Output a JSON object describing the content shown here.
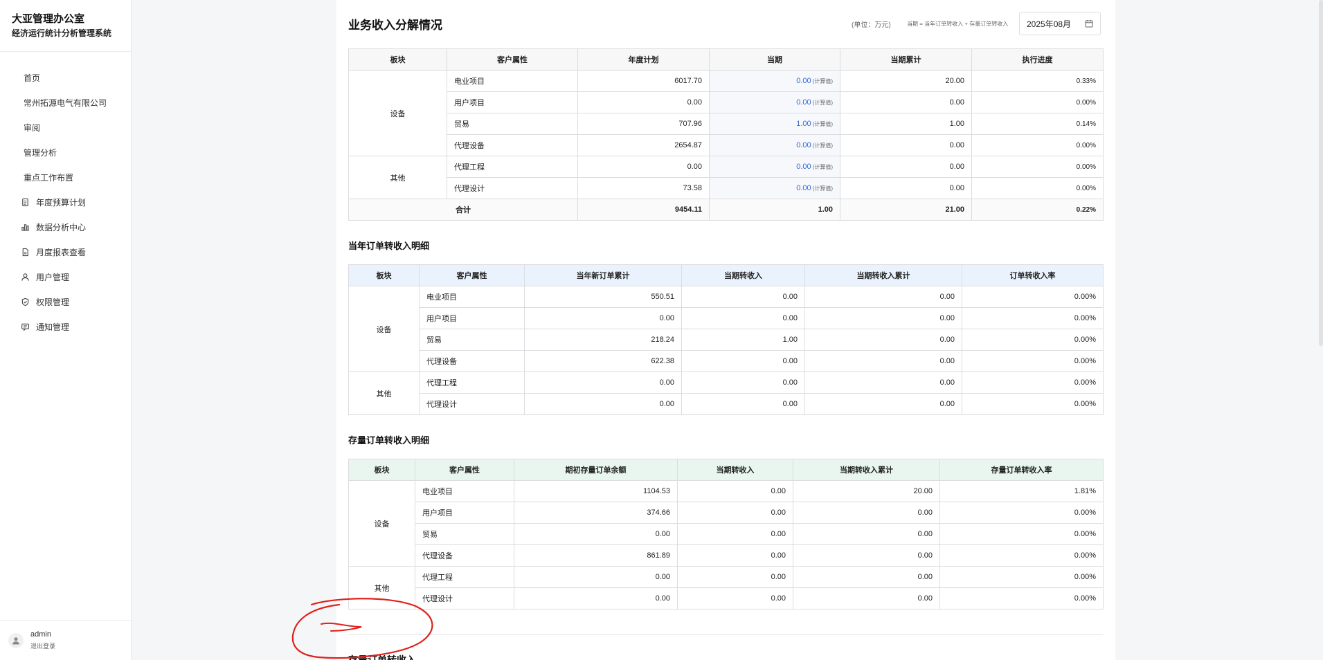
{
  "sidebar": {
    "brand_line1": "大亚管理办公室",
    "brand_line2": "经济运行统计分析管理系统",
    "items": [
      {
        "label": "首页",
        "icon": ""
      },
      {
        "label": "常州拓源电气有限公司",
        "icon": ""
      },
      {
        "label": "审阅",
        "icon": ""
      },
      {
        "label": "管理分析",
        "icon": ""
      },
      {
        "label": "重点工作布置",
        "icon": ""
      },
      {
        "label": "年度预算计划",
        "icon": "document-icon"
      },
      {
        "label": "数据分析中心",
        "icon": "bar-chart-icon"
      },
      {
        "label": "月度报表查看",
        "icon": "file-icon"
      },
      {
        "label": "用户管理",
        "icon": "users-icon"
      },
      {
        "label": "权限管理",
        "icon": "shield-icon"
      },
      {
        "label": "通知管理",
        "icon": "message-icon"
      }
    ],
    "user": {
      "name": "admin",
      "logout": "退出登录"
    }
  },
  "header": {
    "title": "业务收入分解情况",
    "unit": "(单位：万元)",
    "formula": "当期 = 当年订单转收入 + 存量订单转收入",
    "date": "2025年08月"
  },
  "table1": {
    "headers": [
      "板块",
      "客户属性",
      "年度计划",
      "当期",
      "当期累计",
      "执行进度"
    ],
    "calc_note": "(计算值)",
    "groups": [
      {
        "segment": "设备",
        "rows": [
          {
            "attr": "电业项目",
            "plan": "6017.70",
            "current": "0.00",
            "cumulative": "20.00",
            "progress": "0.33%"
          },
          {
            "attr": "用户项目",
            "plan": "0.00",
            "current": "0.00",
            "cumulative": "0.00",
            "progress": "0.00%"
          },
          {
            "attr": "贸易",
            "plan": "707.96",
            "current": "1.00",
            "cumulative": "1.00",
            "progress": "0.14%"
          },
          {
            "attr": "代理设备",
            "plan": "2654.87",
            "current": "0.00",
            "cumulative": "0.00",
            "progress": "0.00%"
          }
        ]
      },
      {
        "segment": "其他",
        "rows": [
          {
            "attr": "代理工程",
            "plan": "0.00",
            "current": "0.00",
            "cumulative": "0.00",
            "progress": "0.00%"
          },
          {
            "attr": "代理设计",
            "plan": "73.58",
            "current": "0.00",
            "cumulative": "0.00",
            "progress": "0.00%"
          }
        ]
      }
    ],
    "total": {
      "label": "合计",
      "plan": "9454.11",
      "current": "1.00",
      "cumulative": "21.00",
      "progress": "0.22%"
    }
  },
  "table2": {
    "title": "当年订单转收入明细",
    "headers": [
      "板块",
      "客户属性",
      "当年新订单累计",
      "当期转收入",
      "当期转收入累计",
      "订单转收入率"
    ],
    "groups": [
      {
        "segment": "设备",
        "rows": [
          [
            "电业项目",
            "550.51",
            "0.00",
            "0.00",
            "0.00%"
          ],
          [
            "用户项目",
            "0.00",
            "0.00",
            "0.00",
            "0.00%"
          ],
          [
            "贸易",
            "218.24",
            "1.00",
            "0.00",
            "0.00%"
          ],
          [
            "代理设备",
            "622.38",
            "0.00",
            "0.00",
            "0.00%"
          ]
        ]
      },
      {
        "segment": "其他",
        "rows": [
          [
            "代理工程",
            "0.00",
            "0.00",
            "0.00",
            "0.00%"
          ],
          [
            "代理设计",
            "0.00",
            "0.00",
            "0.00",
            "0.00%"
          ]
        ]
      }
    ]
  },
  "table3": {
    "title": "存量订单转收入明细",
    "headers": [
      "板块",
      "客户属性",
      "期初存量订单余额",
      "当期转收入",
      "当期转收入累计",
      "存量订单转收入率"
    ],
    "groups": [
      {
        "segment": "设备",
        "rows": [
          [
            "电业项目",
            "1104.53",
            "0.00",
            "20.00",
            "1.81%"
          ],
          [
            "用户项目",
            "374.66",
            "0.00",
            "0.00",
            "0.00%"
          ],
          [
            "贸易",
            "0.00",
            "0.00",
            "0.00",
            "0.00%"
          ],
          [
            "代理设备",
            "861.89",
            "0.00",
            "0.00",
            "0.00%"
          ]
        ]
      },
      {
        "segment": "其他",
        "rows": [
          [
            "代理工程",
            "0.00",
            "0.00",
            "0.00",
            "0.00%"
          ],
          [
            "代理设计",
            "0.00",
            "0.00",
            "0.00",
            "0.00%"
          ]
        ]
      }
    ]
  },
  "next_section": {
    "title": "存量订单转收入"
  },
  "colors": {
    "accent_blue": "#2f6bd8",
    "annotation_red": "#e0201b",
    "t2_header": "#eaf3fd",
    "t3_header": "#e8f6ef"
  }
}
